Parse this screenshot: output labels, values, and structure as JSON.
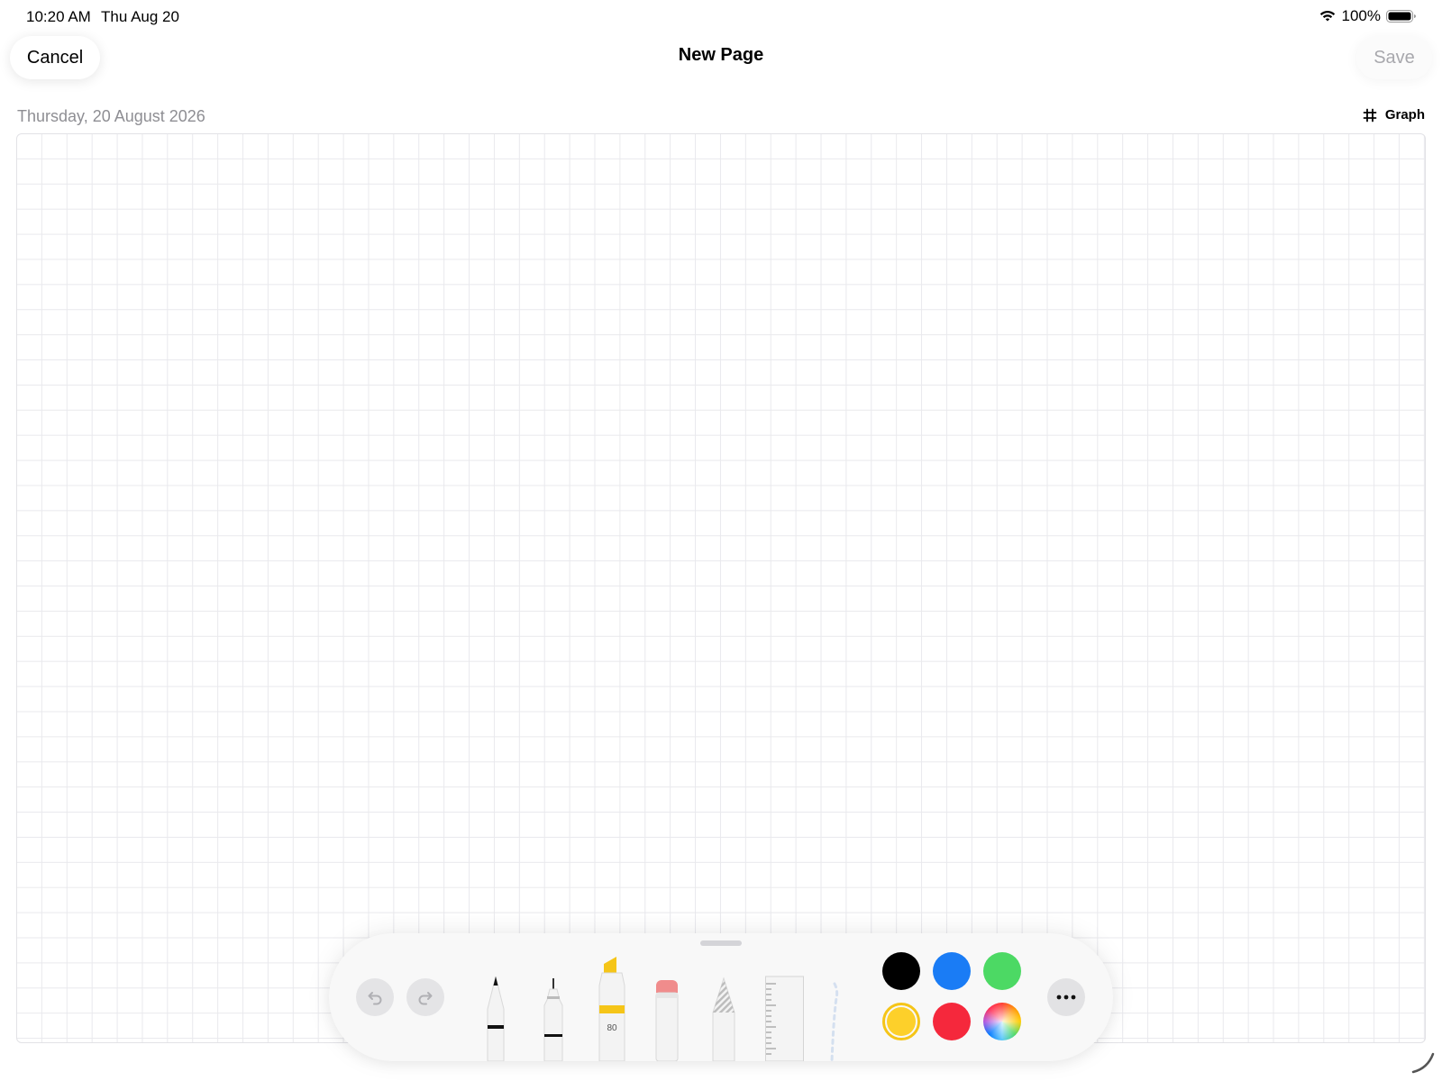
{
  "status_bar": {
    "time": "10:20 AM",
    "date": "Thu Aug 20",
    "battery_percent": "100%",
    "wifi_icon": "wifi-icon",
    "battery_icon": "battery-icon"
  },
  "nav": {
    "cancel_label": "Cancel",
    "title": "New Page",
    "save_label": "Save"
  },
  "page": {
    "date_label": "Thursday, 20 August 2026",
    "paper_style_label": "Graph",
    "paper_style_icon": "grid-hash-icon"
  },
  "palette": {
    "undo_icon": "undo-icon",
    "redo_icon": "redo-icon",
    "more_icon": "ellipsis-icon",
    "tools": [
      {
        "name": "pen",
        "icon": "pen-icon"
      },
      {
        "name": "fineliner",
        "icon": "fineliner-icon"
      },
      {
        "name": "marker",
        "icon": "marker-icon",
        "label": "80",
        "color": "#f5c518"
      },
      {
        "name": "eraser",
        "icon": "eraser-icon",
        "color": "#f08c8c"
      },
      {
        "name": "pencil",
        "icon": "pencil-icon"
      },
      {
        "name": "ruler",
        "icon": "ruler-icon"
      },
      {
        "name": "lasso",
        "icon": "lasso-icon"
      }
    ],
    "colors": [
      {
        "name": "black",
        "hex": "#000000"
      },
      {
        "name": "blue",
        "hex": "#1a7cf5"
      },
      {
        "name": "green",
        "hex": "#4cd964"
      },
      {
        "name": "yellow",
        "hex": "#fdd02a",
        "selected": true
      },
      {
        "name": "red",
        "hex": "#f5283c"
      },
      {
        "name": "color-picker",
        "hex": "multicolor"
      }
    ]
  }
}
